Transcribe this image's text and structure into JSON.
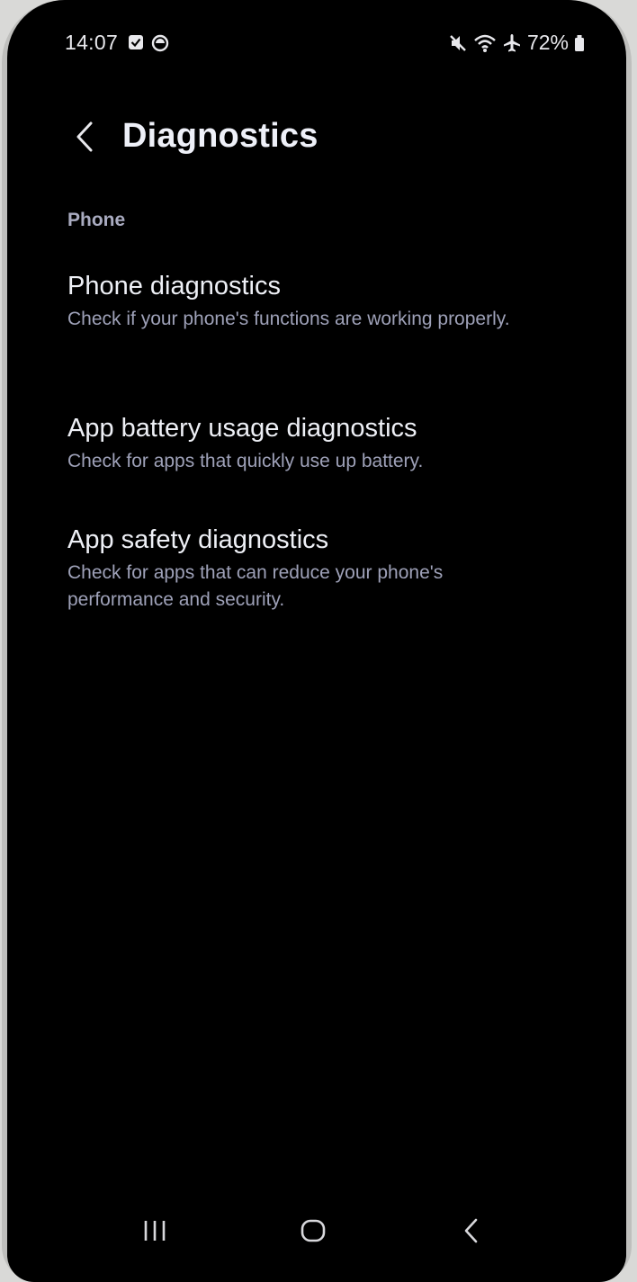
{
  "status_bar": {
    "time": "14:07",
    "battery": "72%",
    "icons": [
      "checkbox-notification-icon",
      "circle-notification-icon",
      "mute-icon",
      "wifi-icon",
      "airplane-icon",
      "battery-icon"
    ]
  },
  "app_bar": {
    "title": "Diagnostics"
  },
  "section": {
    "header": "Phone"
  },
  "items": [
    {
      "title": "Phone diagnostics",
      "subtitle": "Check if your phone's functions are working properly."
    },
    {
      "title": "App battery usage diagnostics",
      "subtitle": "Check for apps that quickly use up battery."
    },
    {
      "title": "App safety diagnostics",
      "subtitle": "Check for apps that can reduce your phone's performance and security."
    }
  ],
  "nav_bar": {
    "icons": [
      "recent-apps-icon",
      "home-icon",
      "back-icon"
    ]
  },
  "colors": {
    "background": "#000000",
    "title_text": "#eef0f6",
    "secondary_text": "#9ea1b8"
  }
}
